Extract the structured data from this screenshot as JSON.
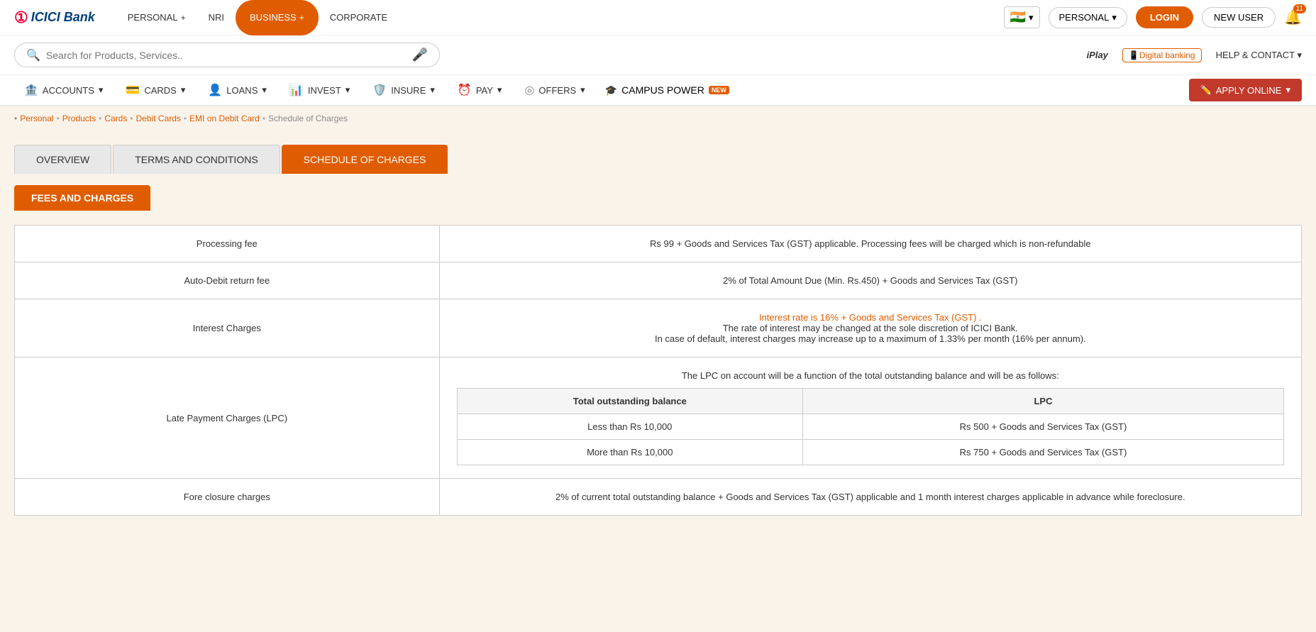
{
  "bank": {
    "name": "ICICI Bank",
    "logo_symbol": "①"
  },
  "topnav": {
    "items": [
      {
        "label": "PERSONAL",
        "has_plus": true,
        "active": false
      },
      {
        "label": "NRI",
        "has_plus": false,
        "active": false
      },
      {
        "label": "BUSINESS",
        "has_plus": true,
        "active": true
      },
      {
        "label": "CORPORATE",
        "has_plus": false,
        "active": false
      }
    ],
    "flag_label": "🇮🇳",
    "personal_btn": "PERSONAL",
    "login_btn": "LOGIN",
    "new_user_btn": "NEW USER",
    "bell_count": "11"
  },
  "search": {
    "placeholder": "Search for Products, Services..",
    "iplay_label": "iPlay",
    "digital_banking_label": "Digital banking",
    "help_contact_label": "HELP & CONTACT"
  },
  "mainnav": {
    "items": [
      {
        "label": "ACCOUNTS",
        "icon": "🏦"
      },
      {
        "label": "CARDS",
        "icon": "💳"
      },
      {
        "label": "LOANS",
        "icon": "👤"
      },
      {
        "label": "INVEST",
        "icon": "📊"
      },
      {
        "label": "INSURE",
        "icon": "🛡️"
      },
      {
        "label": "PAY",
        "icon": "⏰"
      },
      {
        "label": "OFFERS",
        "icon": "◎"
      },
      {
        "label": "CAMPUS POWER",
        "icon": "🎓",
        "badge": "NEW"
      }
    ],
    "apply_online_label": "APPLY ONLINE"
  },
  "breadcrumb": {
    "items": [
      {
        "label": "Personal",
        "link": true
      },
      {
        "label": "Products",
        "link": true
      },
      {
        "label": "Cards",
        "link": true
      },
      {
        "label": "Debit Cards",
        "link": true
      },
      {
        "label": "EMI on Debit Card",
        "link": true
      },
      {
        "label": "Schedule of Charges",
        "link": false
      }
    ]
  },
  "tabs": {
    "items": [
      {
        "label": "OVERVIEW",
        "active": false
      },
      {
        "label": "TERMS AND CONDITIONS",
        "active": false
      },
      {
        "label": "SCHEDULE OF CHARGES",
        "active": true
      }
    ],
    "sub_tab": "FEES AND CHARGES"
  },
  "charges": {
    "rows": [
      {
        "name": "Processing fee",
        "value": "Rs 99 + Goods and Services Tax (GST) applicable. Processing fees will be charged which is non-refundable",
        "type": "simple"
      },
      {
        "name": "Auto-Debit return fee",
        "value": "2% of Total Amount Due (Min. Rs.450) + Goods and Services Tax (GST)",
        "type": "simple"
      },
      {
        "name": "Interest Charges",
        "line1": "Interest rate is 16% + Goods and Services Tax (GST) .",
        "line2": "The rate of interest may be changed at the sole discretion of ICICI Bank.",
        "line3": "In case of default, interest charges may increase up to a maximum of 1.33% per month (16% per annum).",
        "type": "multi"
      },
      {
        "name": "Late Payment Charges (LPC)",
        "intro": "The LPC on account will be a function of the total outstanding balance and will be as follows:",
        "table": {
          "headers": [
            "Total outstanding balance",
            "LPC"
          ],
          "rows": [
            [
              "Less than Rs 10,000",
              "Rs 500 + Goods and Services Tax (GST)"
            ],
            [
              "More than Rs 10,000",
              "Rs 750 + Goods and Services Tax (GST)"
            ]
          ]
        },
        "type": "table"
      },
      {
        "name": "Fore closure charges",
        "value": "2% of current total outstanding balance + Goods and Services Tax (GST) applicable and 1 month interest charges applicable in advance while foreclosure.",
        "type": "simple"
      }
    ]
  }
}
